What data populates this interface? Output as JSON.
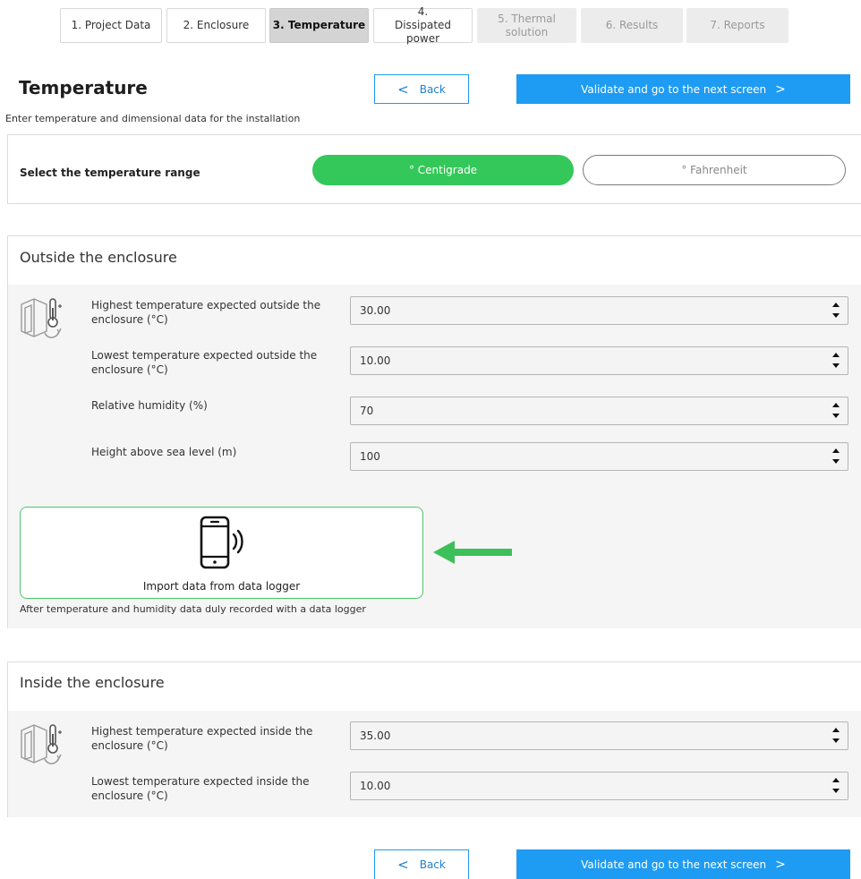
{
  "stepper": [
    {
      "label": "1. Project Data",
      "state": "done"
    },
    {
      "label": "2. Enclosure",
      "state": "done"
    },
    {
      "label": "3. Temperature",
      "state": "active"
    },
    {
      "label": "4. Dissipated power",
      "state": "done"
    },
    {
      "label": "5. Thermal solution",
      "state": "disabled"
    },
    {
      "label": "6. Results",
      "state": "disabled"
    },
    {
      "label": "7. Reports",
      "state": "disabled"
    }
  ],
  "header": {
    "title": "Temperature",
    "subtitle": "Enter temperature and dimensional data for the installation",
    "back_label": "Back",
    "next_label": "Validate and go to the next screen"
  },
  "temperature_range": {
    "label": "Select the temperature range",
    "options": [
      "° Centigrade",
      "° Fahrenheit"
    ],
    "selected": "° Centigrade"
  },
  "outside": {
    "title": "Outside the enclosure",
    "fields": [
      {
        "label": "Highest temperature expected outside the enclosure (°C)",
        "value": "30.00"
      },
      {
        "label": "Lowest temperature expected outside the enclosure (°C)",
        "value": "10.00"
      },
      {
        "label": "Relative humidity (%)",
        "value": "70"
      },
      {
        "label": "Height above sea level (m)",
        "value": "100"
      }
    ],
    "import_label": "Import data from data logger",
    "import_note": "After temperature and humidity data duly recorded with a data logger"
  },
  "inside": {
    "title": "Inside the enclosure",
    "fields": [
      {
        "label": "Highest temperature expected inside the enclosure (°C)",
        "value": "35.00"
      },
      {
        "label": "Lowest temperature expected inside the enclosure (°C)",
        "value": "10.00"
      }
    ]
  },
  "footer": {
    "back_label": "Back",
    "next_label": "Validate and go to the next screen"
  },
  "colors": {
    "primary": "#1e9bf2",
    "success": "#34c759",
    "arrow": "#3cc05a"
  },
  "icons": {
    "enclosure_thermo": "enclosure-thermometer-icon",
    "phone": "phone-signal-icon",
    "arrow": "arrow-left-icon",
    "spinner": "spinner-icon"
  }
}
